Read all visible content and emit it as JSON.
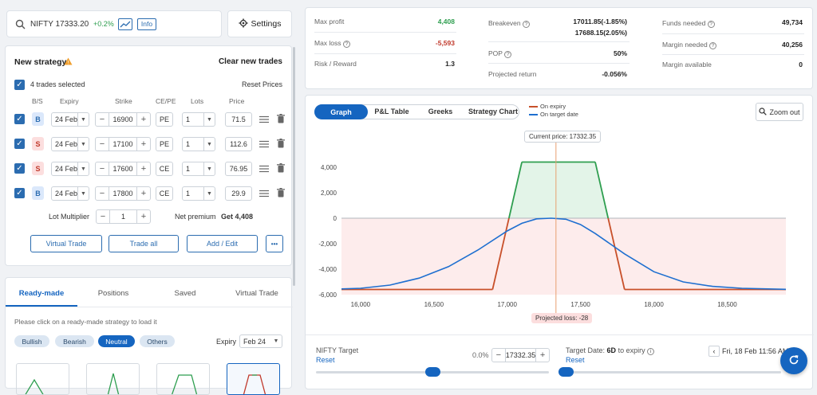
{
  "search": {
    "symbol": "NIFTY 17333.20",
    "change": "+0.2%",
    "info_label": "Info"
  },
  "settings_label": "Settings",
  "strategy": {
    "title": "New strategy",
    "clear_label": "Clear new trades",
    "trades_selected": "4 trades selected",
    "reset_prices": "Reset Prices",
    "headers": [
      "B/S",
      "Expiry",
      "Strike",
      "CE/PE",
      "Lots",
      "Price"
    ],
    "trades": [
      {
        "side": "B",
        "expiry": "24 Feb",
        "strike": "16900",
        "type": "PE",
        "lots": "1",
        "price": "71.5"
      },
      {
        "side": "S",
        "expiry": "24 Feb",
        "strike": "17100",
        "type": "PE",
        "lots": "1",
        "price": "112.6"
      },
      {
        "side": "S",
        "expiry": "24 Feb",
        "strike": "17600",
        "type": "CE",
        "lots": "1",
        "price": "76.95"
      },
      {
        "side": "B",
        "expiry": "24 Feb",
        "strike": "17800",
        "type": "CE",
        "lots": "1",
        "price": "29.9"
      }
    ],
    "lot_multiplier_label": "Lot Multiplier",
    "lot_multiplier": "1",
    "net_premium_label": "Net premium",
    "net_premium": "Get 4,408",
    "virtual_trade": "Virtual Trade",
    "trade_all": "Trade all",
    "add_edit": "Add / Edit",
    "more": "•••"
  },
  "readymade": {
    "tabs": [
      "Ready-made",
      "Positions",
      "Saved",
      "Virtual Trade"
    ],
    "hint": "Please click on a ready-made strategy to load it",
    "chips": [
      "Bullish",
      "Bearish",
      "Neutral",
      "Others"
    ],
    "expiry_label": "Expiry",
    "expiry_value": "Feb 24"
  },
  "metrics": {
    "max_profit_label": "Max profit",
    "max_profit": "4,408",
    "max_loss_label": "Max loss",
    "max_loss": "-5,593",
    "rr_label": "Risk / Reward",
    "rr": "1.3",
    "breakeven_label": "Breakeven",
    "breakeven_1": "17011.85(-1.85%)",
    "breakeven_2": "17688.15(2.05%)",
    "pop_label": "POP",
    "pop": "50%",
    "proj_return_label": "Projected return",
    "proj_return": "-0.056%",
    "funds_label": "Funds needed",
    "funds": "49,734",
    "margin_label": "Margin needed",
    "margin": "40,256",
    "margin_avail_label": "Margin available",
    "margin_avail": "0"
  },
  "chart_tabs": [
    "Graph",
    "P&L Table",
    "Greeks",
    "Strategy Chart"
  ],
  "legend": {
    "expiry": "On expiry",
    "target": "On target date"
  },
  "zoom_label": "Zoom out",
  "current_price_label": "Current price: 17332.35",
  "projected_loss_label": "Projected loss: -28",
  "target": {
    "nifty_label": "NIFTY Target",
    "reset": "Reset",
    "pct": "0.0%",
    "value": "17332.35",
    "date_label": "Target Date:",
    "days": "6D",
    "days_suffix": "to expiry",
    "date_value": "Fri, 18 Feb 11:56 AM",
    "date_reset": "Reset"
  },
  "colors": {
    "accent": "#1565c0",
    "profit": "#2e9e4f",
    "loss": "#c0392b",
    "expiry_line": "#c8502a",
    "target_line": "#1e6fd0"
  },
  "chart_data": {
    "type": "line",
    "x_ticks": [
      16000,
      16500,
      17000,
      17500,
      18000,
      18500
    ],
    "y_ticks": [
      4000,
      2000,
      0,
      -2000,
      -4000,
      -6000
    ],
    "xlim": [
      15870,
      18900
    ],
    "ylim": [
      -6000,
      4500
    ],
    "current_price": 17332.35,
    "series": [
      {
        "name": "On expiry",
        "x": [
          15870,
          16900,
          17100,
          17600,
          17800,
          18900
        ],
        "y": [
          -5593,
          -5593,
          4408,
          4408,
          -5593,
          -5593
        ]
      },
      {
        "name": "On target date",
        "x": [
          15870,
          16000,
          16200,
          16400,
          16600,
          16800,
          17000,
          17100,
          17200,
          17300,
          17400,
          17500,
          17600,
          17800,
          18000,
          18200,
          18400,
          18600,
          18900
        ],
        "y": [
          -5550,
          -5500,
          -5250,
          -4700,
          -3800,
          -2500,
          -1000,
          -400,
          -50,
          0,
          -80,
          -500,
          -1200,
          -2800,
          -4200,
          -5000,
          -5350,
          -5500,
          -5580
        ]
      }
    ]
  }
}
